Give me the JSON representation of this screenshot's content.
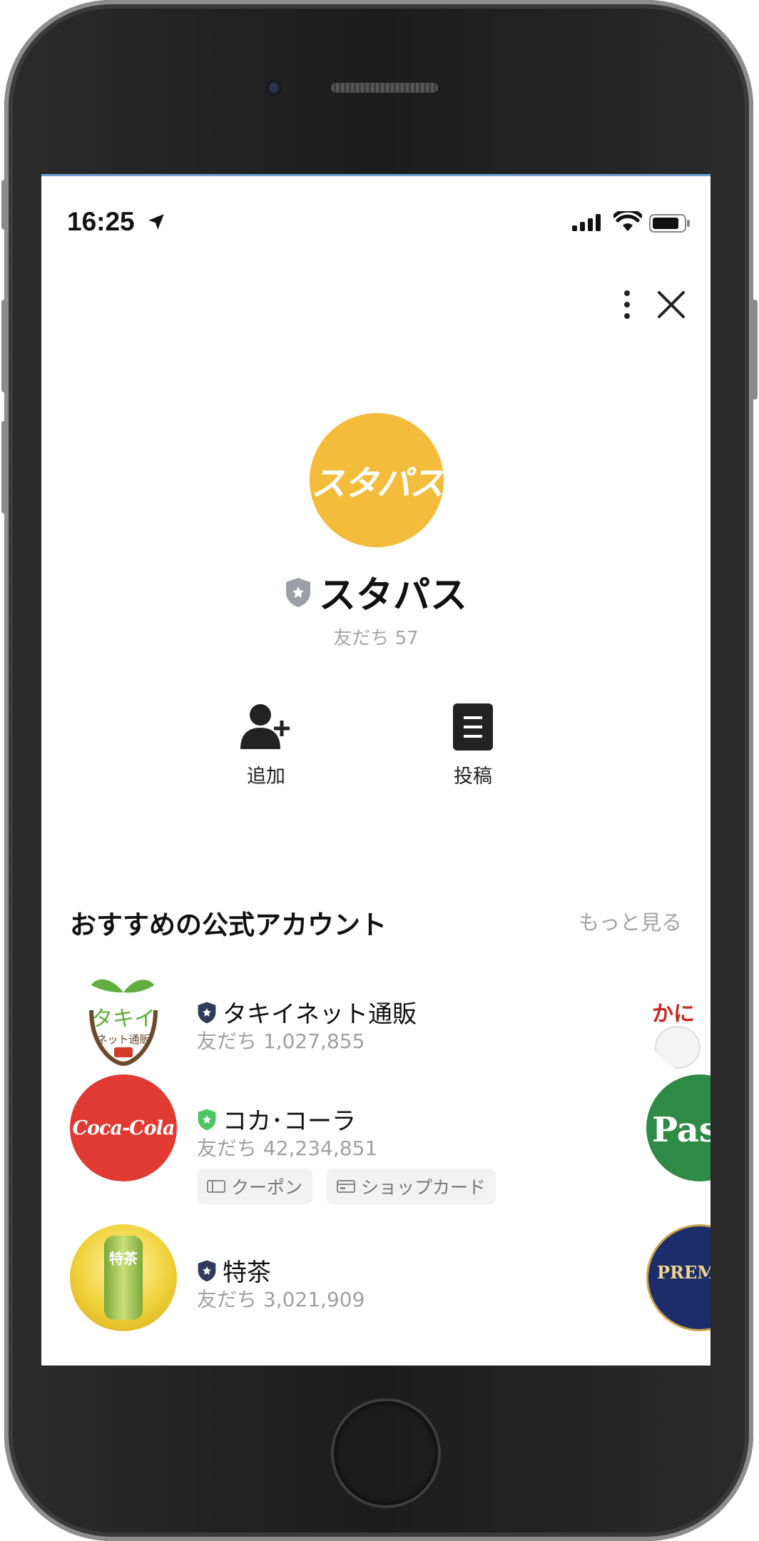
{
  "status_bar": {
    "time": "16:25"
  },
  "profile": {
    "logo_text": "スタパス",
    "name": "スタパス",
    "friends": "友だち 57",
    "avatar_color": "#f3bd3b"
  },
  "actions": [
    {
      "label": "追加",
      "icon": "add-friend-icon"
    },
    {
      "label": "投稿",
      "icon": "posts-icon"
    }
  ],
  "recommended": {
    "title": "おすすめの公式アカウント",
    "see_more": "もっと見る",
    "accounts": [
      {
        "name": "タキイネット通販",
        "friends": "友だち 1,027,855",
        "badge_color": "#2f3a5c",
        "logo_text": "タキイ",
        "logo_sub": "ネット通販"
      },
      {
        "name": "コカ･コーラ",
        "friends": "友だち 42,234,851",
        "badge_color": "#4cc764",
        "logo_text": "Coca-Cola",
        "tags": [
          "クーポン",
          "ショップカード"
        ]
      },
      {
        "name": "特茶",
        "friends": "友だち 3,021,909",
        "badge_color": "#2f3a5c",
        "logo_text": "特茶"
      }
    ],
    "peek_logos": [
      "かに",
      "Pas",
      "PREMI"
    ]
  }
}
